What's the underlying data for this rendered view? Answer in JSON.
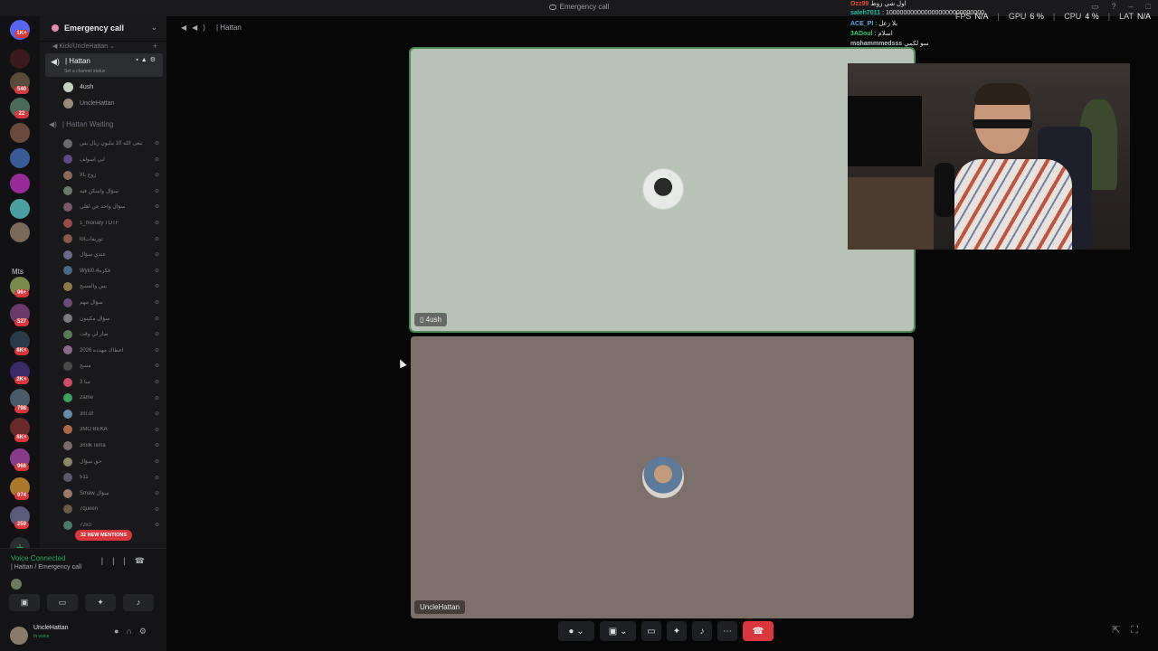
{
  "window": {
    "title": "Emergency call"
  },
  "server": {
    "name": "Emergency call",
    "category": "Kick/UncleHattan"
  },
  "rail": {
    "badges": [
      "1K+",
      "540",
      "22",
      "96+",
      "527",
      "6K+",
      "2K+",
      "798",
      "6K+",
      "966",
      "974",
      "259"
    ],
    "folder_label": "Mts"
  },
  "channels": {
    "active": {
      "name": "| Hattan",
      "status_placeholder": "Set a channel status"
    },
    "active_members": [
      "4ush",
      "UncleHattan"
    ],
    "waiting": {
      "name": "| Hattan Waiting"
    },
    "waiting_members": [
      "نبغى الله 10 مليون ريال بس",
      "ابي اسولف",
      "زوج بالأ",
      "سؤال واسكن فيه",
      "سؤال واحد عن اهلي",
      "1_monafy TOTF",
      "lolتوريفات",
      "عندي سؤال",
      "Wyki0.4فكره",
      "بس والمسح",
      "سؤال مهم",
      "سؤال مكينون",
      "صار لي وقت",
      "2026 اعطاك مهدده",
      "مسح",
      "3 منا",
      "2ame",
      "3m.of",
      "3MO BEKA",
      "3milk nima",
      "حق سؤال",
      "511",
      "Smaw سؤال",
      "7queen",
      "72x0"
    ],
    "new_mentions": "32 NEW MENTIONS"
  },
  "voice": {
    "status": "Voice Connected",
    "channel": "| Hattan / Emergency call",
    "user_name": "UncleHattan",
    "user_status": "In voice"
  },
  "main": {
    "header": "| Hattan",
    "tiles": [
      "4ush",
      "UncleHattan"
    ]
  },
  "overlay": {
    "chat": [
      {
        "user": "Ozz99",
        "text": "اول شي زوط",
        "color": "#e74c3c"
      },
      {
        "user": "saleh7011",
        "text": ": 1000000000000000000000000000",
        "color": "#1abc9c"
      },
      {
        "user": "ACE_PI",
        "text": ": بلا زعل",
        "color": "#5dade2"
      },
      {
        "user": "3ADoul",
        "text": ": اسلام",
        "color": "#2ecc71"
      },
      {
        "user": "mohammmedsss",
        "text": "سو لكمي",
        "color": "#bdc3c7"
      }
    ],
    "stats": [
      {
        "label": "FPS",
        "value": "N/A"
      },
      {
        "label": "GPU",
        "value": "6 %"
      },
      {
        "label": "CPU",
        "value": "4 %"
      },
      {
        "label": "LAT",
        "value": "N/A"
      }
    ]
  },
  "colors": {
    "accent_green": "#23a559",
    "danger": "#da373c",
    "tile_top_bg": "#b8c3b7",
    "tile_bottom_bg": "#7d706a"
  }
}
